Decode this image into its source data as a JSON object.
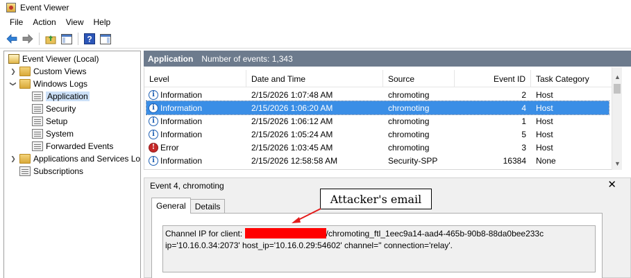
{
  "window": {
    "title": "Event Viewer"
  },
  "menu": [
    "File",
    "Action",
    "View",
    "Help"
  ],
  "tree": [
    {
      "label": "Event Viewer (Local)",
      "icon": "event-viewer-icon"
    },
    {
      "label": "Custom Views",
      "icon": "folder-icon"
    },
    {
      "label": "Windows Logs",
      "icon": "folder-icon"
    },
    {
      "label": "Application",
      "icon": "log-icon"
    },
    {
      "label": "Security",
      "icon": "log-icon"
    },
    {
      "label": "Setup",
      "icon": "log-icon"
    },
    {
      "label": "System",
      "icon": "log-icon"
    },
    {
      "label": "Forwarded Events",
      "icon": "log-icon"
    },
    {
      "label": "Applications and Services Lo",
      "icon": "folder-icon"
    },
    {
      "label": "Subscriptions",
      "icon": "log-icon"
    }
  ],
  "header": {
    "title": "Application",
    "count": "Number of events: 1,343"
  },
  "columns": {
    "level": "Level",
    "date": "Date and Time",
    "source": "Source",
    "event_id": "Event ID",
    "task": "Task Category"
  },
  "events": [
    {
      "level": "Information",
      "date": "2/15/2026 1:07:48 AM",
      "source": "chromoting",
      "event_id": "2",
      "task": "Host"
    },
    {
      "level": "Information",
      "date": "2/15/2026 1:06:20 AM",
      "source": "chromoting",
      "event_id": "4",
      "task": "Host"
    },
    {
      "level": "Information",
      "date": "2/15/2026 1:06:12 AM",
      "source": "chromoting",
      "event_id": "1",
      "task": "Host"
    },
    {
      "level": "Information",
      "date": "2/15/2026 1:05:24 AM",
      "source": "chromoting",
      "event_id": "5",
      "task": "Host"
    },
    {
      "level": "Error",
      "date": "2/15/2026 1:03:45 AM",
      "source": "chromoting",
      "event_id": "3",
      "task": "Host"
    },
    {
      "level": "Information",
      "date": "2/15/2026 12:58:58 AM",
      "source": "Security-SPP",
      "event_id": "16384",
      "task": "None"
    }
  ],
  "detail": {
    "title": "Event 4, chromoting",
    "tabs": [
      "General",
      "Details"
    ],
    "line1_prefix": "Channel IP for client:",
    "line1_suffix": "/chromoting_ftl_1eec9a14-aad4-465b-90b8-88da0bee233c",
    "line2": "ip='10.16.0.34:2073' host_ip='10.16.0.29:54602' channel='' connection='relay'."
  },
  "annotation": {
    "label": "Attacker's email"
  },
  "colors": {
    "header_bg": "#6d7b8d",
    "selection": "#3a8ee6",
    "redaction": "#ff0000"
  }
}
